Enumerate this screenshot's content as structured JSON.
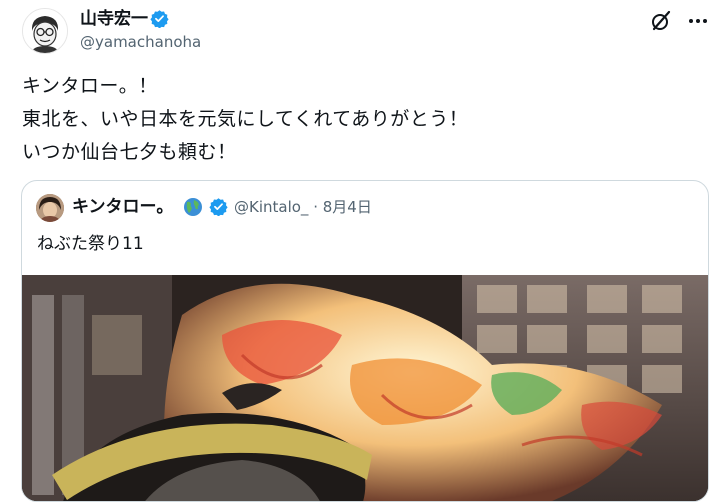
{
  "post": {
    "author": {
      "display_name": "山寺宏一",
      "handle": "@yamachanoha",
      "verified": true,
      "avatar_icon": "caricature-avatar"
    },
    "lines": [
      "キンタロー。！",
      "東北を、いや日本を元気にしてくれてありがとう！",
      "いつか仙台七夕も頼む！"
    ],
    "header_icons": [
      "grok-icon",
      "more-icon"
    ]
  },
  "quote": {
    "author": {
      "display_name": "キンタロー。",
      "badge_emoji": "globe-icon",
      "verified": true,
      "handle_and_date": "@Kintalo_ · 8月4日"
    },
    "text": "ねぶた祭り11",
    "media_description_icon": "nebuta-photo"
  },
  "colors": {
    "verified_blue": "#1d9bf0",
    "secondary_text": "#536471",
    "border": "#cfd9de"
  }
}
